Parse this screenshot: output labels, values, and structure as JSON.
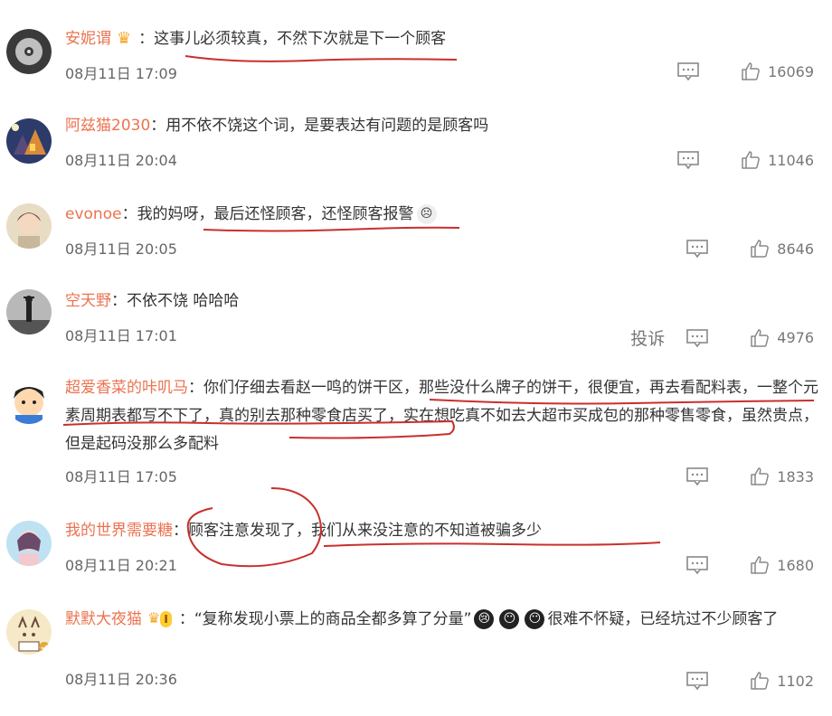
{
  "comments": [
    {
      "name": "安妮谓",
      "badge": "crown",
      "text": "这事儿必须较真，不然下次就是下一个顾客",
      "time": "08月11日 17:09",
      "likes": "16069",
      "avatar_colors": [
        "#444",
        "#bbb"
      ]
    },
    {
      "name": "阿兹猫2030",
      "text": "用不依不饶这个词，是要表达有问题的是顾客吗",
      "time": "08月11日 20:04",
      "likes": "11046",
      "avatar_colors": [
        "#2d3b6a",
        "#d98a3a"
      ]
    },
    {
      "name": "evonoe",
      "text": "我的妈呀，最后还怪顾客，还怪顾客报警",
      "time": "08月11日 20:05",
      "likes": "8646",
      "avatar_colors": [
        "#d8c8a8",
        "#6b4a3a"
      ]
    },
    {
      "name": "空天野",
      "text": "不依不饶 哈哈哈",
      "time": "08月11日 17:01",
      "likes": "4976",
      "report": "投诉",
      "avatar_colors": [
        "#999",
        "#444"
      ]
    },
    {
      "name": "超爱香菜的咔叽马",
      "text": "你们仔细去看赵一鸣的饼干区，那些没什么牌子的饼干，很便宜，再去看配料表，一整个元素周期表都写不下了，真的别去那种零食店买了，实在想吃真不如去大超市买成包的那种零售零食，虽然贵点，但是起码没那么多配料",
      "time": "08月11日 17:05",
      "likes": "1833",
      "avatar_colors": [
        "#3a7bd5",
        "#ffd39a"
      ]
    },
    {
      "name": "我的世界需要糖",
      "text": "顾客注意发现了，我们从来没注意的不知道被骗多少",
      "time": "08月11日 20:21",
      "likes": "1680",
      "avatar_colors": [
        "#9fd3ea",
        "#f3c9d0"
      ]
    },
    {
      "name": "默默大夜猫",
      "badge": "vip",
      "badge_text": "I",
      "text": "“复称发现小票上的商品全都多算了分量”",
      "text_after": "很难不怀疑，已经坑过不少顾客了",
      "time": "08月11日 20:36",
      "likes": "1102",
      "avatar_colors": [
        "#f5e9c8",
        "#e6a83a"
      ]
    }
  ],
  "separator": "：",
  "emoji_faces": [
    "😢",
    "😶",
    "😶"
  ],
  "watermark": ""
}
